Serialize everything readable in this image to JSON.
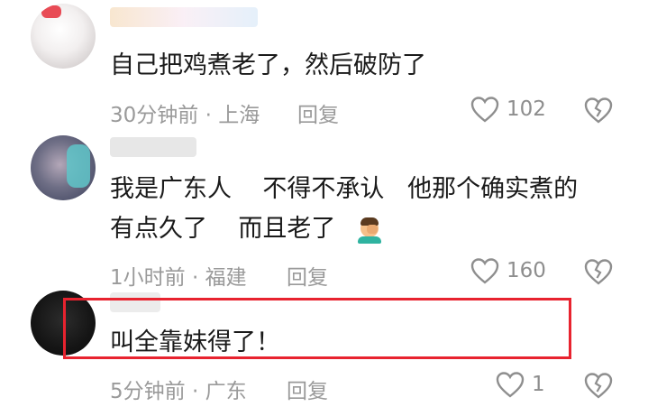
{
  "comments": [
    {
      "text": "自己把鸡煮老了，然后破防了",
      "time": "30分钟前",
      "location": "上海",
      "reply_label": "回复",
      "likes": "102",
      "avatar_icon": "cartoon-cat-avatar"
    },
    {
      "text_line1": "我是广东人    不得不承认   他那个确实煮的",
      "text_line2": "有点久了    而且老了",
      "emoji_icon": "facepalm-emoji",
      "time": "1小时前",
      "location": "福建",
      "reply_label": "回复",
      "likes": "160",
      "avatar_icon": "user-photo-avatar"
    },
    {
      "text": "叫全靠妹得了！",
      "time": "5分钟前",
      "location": "广东",
      "reply_label": "回复",
      "likes": "1",
      "avatar_icon": "dark-avatar",
      "highlighted": true
    }
  ],
  "colors": {
    "highlight_border": "#e8232f",
    "meta_text": "#9a9a9a",
    "body_text": "#1a1a1a"
  }
}
